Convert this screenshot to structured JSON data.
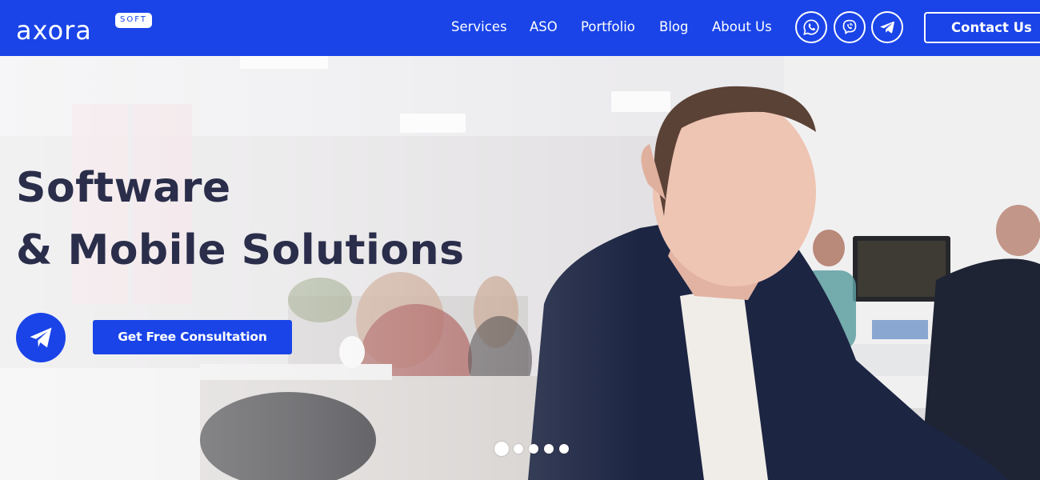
{
  "brand": {
    "name": "axora",
    "badge": "SOFT",
    "accent": "#1a44e8",
    "title_color": "#2a2e4a"
  },
  "nav": {
    "items": [
      {
        "label": "Services"
      },
      {
        "label": "ASO"
      },
      {
        "label": "Portfolio"
      },
      {
        "label": "Blog"
      },
      {
        "label": "About Us"
      }
    ],
    "social": [
      {
        "icon": "whatsapp-icon"
      },
      {
        "icon": "viber-icon"
      },
      {
        "icon": "telegram-icon"
      }
    ],
    "contact_label": "Contact Us"
  },
  "hero": {
    "title_line1": "Software",
    "title_line2": "& Mobile Solutions",
    "send_icon": "paper-plane-icon",
    "cta_label": "Get Free Consultation",
    "slider": {
      "total": 5,
      "active": 1
    }
  }
}
